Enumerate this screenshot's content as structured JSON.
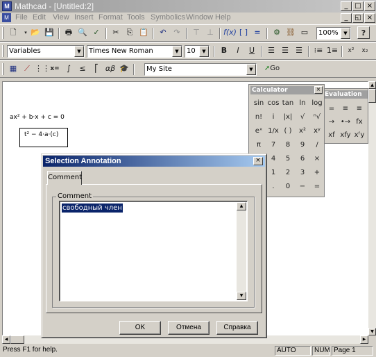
{
  "app": {
    "title": "Mathcad - [Untitled:2]"
  },
  "menu": [
    "File",
    "Edit",
    "View",
    "Insert",
    "Format",
    "Tools",
    "Symbolics",
    "Window",
    "Help"
  ],
  "toolbar_standard": {
    "zoom": "100%",
    "help_label": "?"
  },
  "toolbar_format": {
    "style": "Variables",
    "font": "Times New Roman",
    "size": "10",
    "bold": "B",
    "italic": "I",
    "underline": "U",
    "superscript": "x²",
    "subscript": "x₂"
  },
  "toolbar_resources": {
    "site": "My Site",
    "go_label": "Go"
  },
  "worksheet": {
    "equation": "ax² + b·x + c = 0",
    "expression": "t² − 4·a·(c)"
  },
  "calculator": {
    "title": "Calculator",
    "close": "×",
    "rows": [
      [
        "sin",
        "cos",
        "tan",
        "ln",
        "log"
      ],
      [
        "n!",
        "i",
        "|x|",
        "√",
        "ⁿ√"
      ],
      [
        "eˣ",
        "1/x",
        "( )",
        "x²",
        "xʸ"
      ],
      [
        "π",
        "7",
        "8",
        "9",
        "/"
      ],
      [
        "",
        "4",
        "5",
        "6",
        "×"
      ],
      [
        "",
        "1",
        "2",
        "3",
        "+"
      ],
      [
        "",
        ".",
        "0",
        "−",
        "="
      ]
    ]
  },
  "evaluation": {
    "title": "Evaluation",
    "close": "×",
    "rows": [
      [
        "=",
        "≡",
        "≡"
      ],
      [
        "→",
        "•→",
        "fx"
      ],
      [
        "xf",
        "xfy",
        "xᶠy"
      ]
    ]
  },
  "dialog": {
    "title": "Selection Annotation",
    "close": "×",
    "tab": "Comment",
    "group_label": "Comment",
    "comment_text": "свободный член",
    "ok": "OK",
    "cancel": "Отмена",
    "help": "Справка"
  },
  "status": {
    "hint": "Press F1 for help.",
    "auto": "AUTO",
    "num": "NUM",
    "page": "Page 1"
  }
}
